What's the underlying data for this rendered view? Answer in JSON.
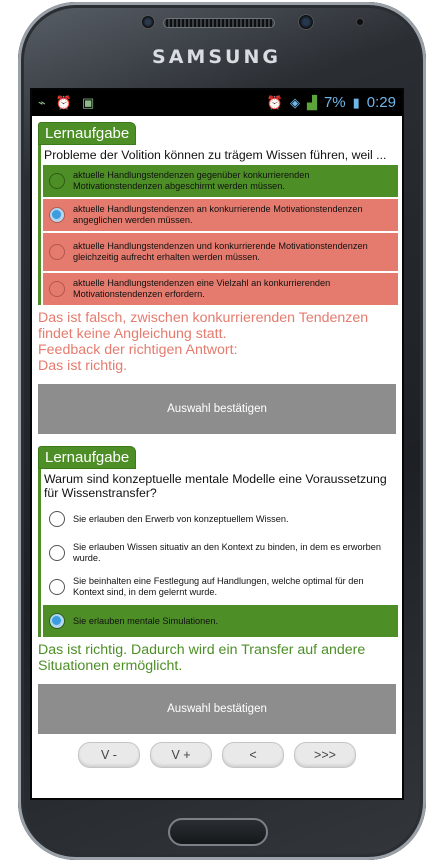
{
  "device": {
    "brand": "SAMSUNG"
  },
  "statusbar": {
    "battery": "7%",
    "time": "0:29"
  },
  "task1": {
    "tag": "Lernaufgabe",
    "question": "Probleme der Volition können zu trägem Wissen führen, weil ...",
    "options": [
      "aktuelle Handlungstendenzen gegenüber konkurrierenden Motivationstendenzen abgeschirmt werden müssen.",
      "aktuelle Handlungstendenzen an konkurrierende Motivationstendenzen angeglichen werden müssen.",
      "aktuelle Handlungstendenzen und konkurrierende Motivationstendenzen gleichzeitig aufrecht erhalten werden müssen.",
      "aktuelle Handlungstendenzen eine Vielzahl an konkurrierenden Motivationstendenzen erfordern."
    ],
    "feedback": [
      "Das ist falsch, zwischen konkurrierenden Tendenzen findet keine Angleichung statt.",
      "Feedback der richtigen Antwort:",
      "Das ist richtig."
    ],
    "confirm_label": "Auswahl bestätigen"
  },
  "task2": {
    "tag": "Lernaufgabe",
    "question": "Warum sind konzeptuelle mentale Modelle eine Voraussetzung für Wissenstransfer?",
    "options": [
      "Sie erlauben den Erwerb von konzeptuellem Wissen.",
      "Sie erlauben Wissen situativ an den Kontext zu binden, in dem es erworben wurde.",
      "Sie beinhalten eine Festlegung auf Handlungen, welche optimal für den Kontext sind, in dem gelernt wurde.",
      "Sie erlauben mentale Simulationen."
    ],
    "feedback": "Das ist richtig. Dadurch wird ein Transfer auf andere Situationen ermöglicht.",
    "confirm_label": "Auswahl bestätigen"
  },
  "nav": {
    "v_minus": "V -",
    "v_plus": "V +",
    "back": "<",
    "next": ">>>"
  },
  "colors": {
    "correct": "#4d8f26",
    "wrong": "#e57b6e",
    "button": "#8d8d8d"
  }
}
